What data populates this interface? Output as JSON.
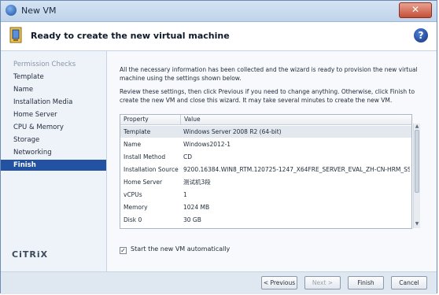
{
  "window": {
    "title": "New VM",
    "close_label": "✕"
  },
  "header": {
    "title": "Ready to create the new virtual machine",
    "help": "?"
  },
  "sidebar": {
    "items": [
      {
        "label": "Permission Checks",
        "state": "dim"
      },
      {
        "label": "Template",
        "state": "normal"
      },
      {
        "label": "Name",
        "state": "normal"
      },
      {
        "label": "Installation Media",
        "state": "normal"
      },
      {
        "label": "Home Server",
        "state": "normal"
      },
      {
        "label": "CPU & Memory",
        "state": "normal"
      },
      {
        "label": "Storage",
        "state": "normal"
      },
      {
        "label": "Networking",
        "state": "normal"
      },
      {
        "label": "Finish",
        "state": "active"
      }
    ],
    "brand": "CiTRiX"
  },
  "content": {
    "intro": "All the necessary information has been collected and the wizard is ready to provision the new virtual machine using the settings shown below.",
    "review": "Review these settings, then click Previous if you need to change anything. Otherwise, click Finish to create the new VM and close this wizard. It may take several minutes to create the new VM.",
    "grid": {
      "headers": [
        "Property",
        "Value"
      ],
      "rows": [
        {
          "property": "Template",
          "value": "Windows Server 2008 R2 (64-bit)"
        },
        {
          "property": "Name",
          "value": "Windows2012-1"
        },
        {
          "property": "Install Method",
          "value": "CD"
        },
        {
          "property": "Installation Source",
          "value": "9200.16384.WIN8_RTM.120725-1247_X64FRE_SERVER_EVAL_ZH-CN-HRM_SSS_X64..."
        },
        {
          "property": "Home Server",
          "value": "测试机3段"
        },
        {
          "property": "vCPUs",
          "value": "1"
        },
        {
          "property": "Memory",
          "value": "1024 MB"
        },
        {
          "property": "Disk 0",
          "value": "30 GB"
        }
      ]
    },
    "start_auto_label": "Start the new VM automatically",
    "start_auto_checked": true
  },
  "footer": {
    "previous": "< Previous",
    "next": "Next >",
    "finish": "Finish",
    "cancel": "Cancel"
  }
}
